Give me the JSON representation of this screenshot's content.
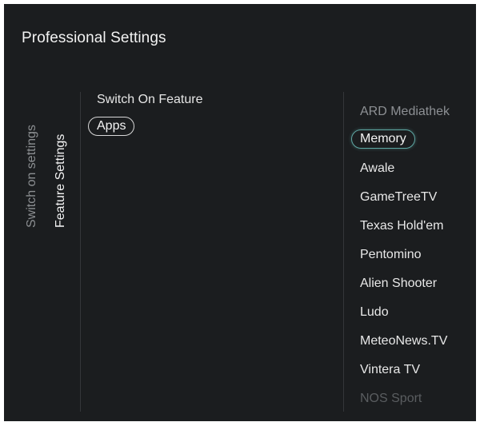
{
  "header": {
    "title": "Professional Settings"
  },
  "tabs": [
    {
      "label": "Switch on settings",
      "state": "inactive"
    },
    {
      "label": "Feature Settings",
      "state": "active"
    }
  ],
  "feature": {
    "heading": "Switch On Feature",
    "selected_option": "Apps"
  },
  "apps": [
    {
      "label": "ARD Mediathek",
      "state": "dim"
    },
    {
      "label": "Memory",
      "state": "selected"
    },
    {
      "label": "Awale",
      "state": "normal"
    },
    {
      "label": "GameTreeTV",
      "state": "normal"
    },
    {
      "label": "Texas Hold'em",
      "state": "normal"
    },
    {
      "label": "Pentomino",
      "state": "normal"
    },
    {
      "label": "Alien Shooter",
      "state": "normal"
    },
    {
      "label": "Ludo",
      "state": "normal"
    },
    {
      "label": "MeteoNews.TV",
      "state": "normal"
    },
    {
      "label": "Vintera TV",
      "state": "normal"
    },
    {
      "label": "NOS Sport",
      "state": "faint"
    }
  ],
  "colors": {
    "background": "#1b1d1f",
    "focus_outline": "#5fa8a4",
    "inactive_text": "#8c8f92"
  }
}
